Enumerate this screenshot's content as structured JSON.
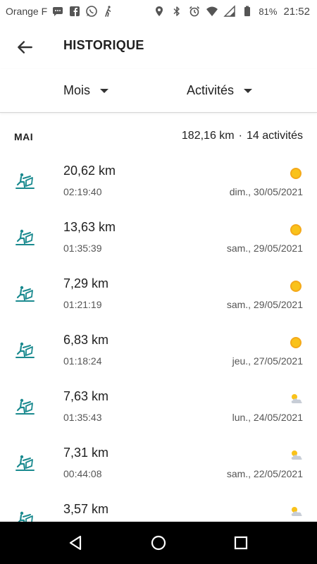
{
  "status_bar": {
    "carrier": "Orange F",
    "battery": "81%",
    "time": "21:52",
    "icons_left": [
      "message-icon",
      "facebook-icon",
      "whatsapp-icon",
      "walking-icon"
    ],
    "icons_right": [
      "location-icon",
      "bluetooth-icon",
      "alarm-icon",
      "wifi-icon",
      "signal-icon",
      "battery-icon"
    ]
  },
  "header": {
    "title": "HISTORIQUE",
    "back_icon": "arrow-left-icon"
  },
  "filters": {
    "period": "Mois",
    "type": "Activités"
  },
  "section": {
    "month": "MAI",
    "distance_total": "182,16 km",
    "separator": "·",
    "activity_count": "14 activités"
  },
  "activities": [
    {
      "distance": "20,62 km",
      "duration": "02:19:40",
      "date": "dim., 30/05/2021",
      "weather": "sun"
    },
    {
      "distance": "13,63 km",
      "duration": "01:35:39",
      "date": "sam., 29/05/2021",
      "weather": "sun"
    },
    {
      "distance": "7,29 km",
      "duration": "01:21:19",
      "date": "sam., 29/05/2021",
      "weather": "sun"
    },
    {
      "distance": "6,83 km",
      "duration": "01:18:24",
      "date": "jeu., 27/05/2021",
      "weather": "sun"
    },
    {
      "distance": "7,63 km",
      "duration": "01:35:43",
      "date": "lun., 24/05/2021",
      "weather": "partly-cloudy"
    },
    {
      "distance": "7,31 km",
      "duration": "00:44:08",
      "date": "sam., 22/05/2021",
      "weather": "partly-cloudy"
    },
    {
      "distance": "3,57 km",
      "duration": "",
      "date": "",
      "weather": "partly-cloudy"
    }
  ],
  "colors": {
    "accent": "#1a8a8f",
    "sun": "#f9c21a",
    "cloud": "#c7cdd6"
  }
}
